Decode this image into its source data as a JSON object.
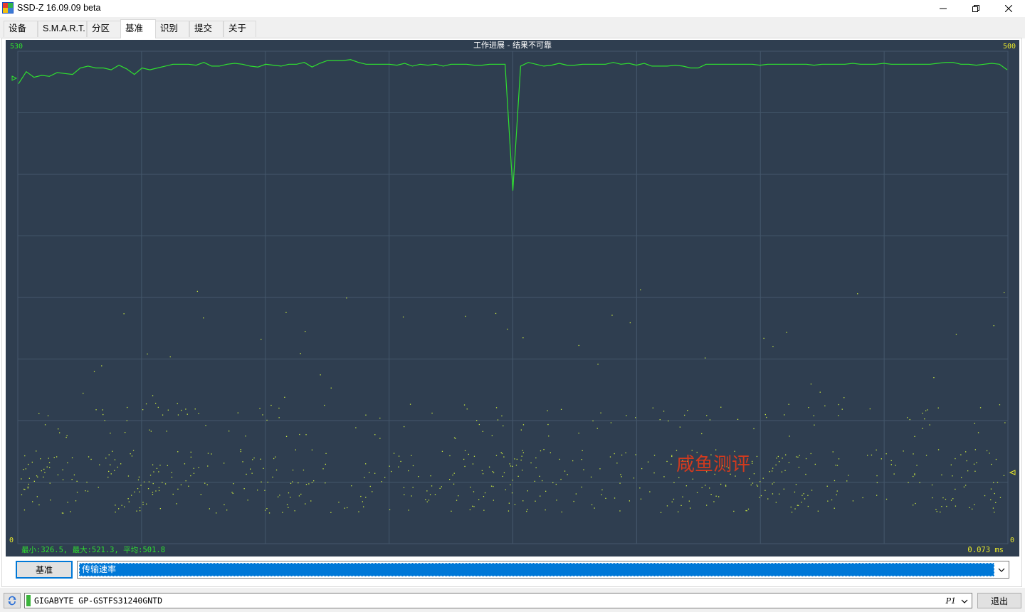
{
  "window": {
    "title": "SSD-Z 16.09.09 beta",
    "minimize_icon": "minimize-icon",
    "restore_icon": "restore-icon",
    "close_icon": "close-icon"
  },
  "tabs": [
    {
      "label": "设备"
    },
    {
      "label": "S.M.A.R.T."
    },
    {
      "label": "分区"
    },
    {
      "label": "基准",
      "active": true
    },
    {
      "label": "识别"
    },
    {
      "label": "提交"
    },
    {
      "label": "关于"
    }
  ],
  "chart_data": {
    "type": "line",
    "title": "工作进展 - 结果不可靠",
    "left_axis": {
      "max_label": "530",
      "min_label": "0",
      "range": [
        0,
        530
      ]
    },
    "right_axis": {
      "max_label": "500",
      "min_label": "0",
      "range": [
        0,
        500
      ]
    },
    "stats_text": "最小:326.5, 最大:521.3, 平均:501.8",
    "latency_text": "0.073 ms",
    "watermark": "咸鱼测评",
    "colors": {
      "background": "#2f3e50",
      "grid": "#44576b",
      "line": "#2fe02f",
      "dots": "#c8e640",
      "axis_label_left": "#2fe02f",
      "axis_label_right": "#e8e82a",
      "watermark": "#d23a1e"
    },
    "grid": true,
    "series": [
      {
        "values": [
          495,
          508,
          502,
          504,
          503,
          507,
          506,
          505,
          512,
          514,
          512,
          512,
          510,
          515,
          511,
          505,
          512,
          510,
          512,
          514,
          516,
          516,
          516,
          515,
          518,
          514,
          514,
          516,
          517,
          516,
          514,
          513,
          516,
          515,
          514,
          516,
          516,
          518,
          513,
          517,
          520,
          520,
          520,
          521,
          518,
          516,
          516,
          516,
          516,
          515,
          517,
          514,
          516,
          515,
          516,
          514,
          516,
          516,
          516,
          515,
          515,
          516,
          516,
          516,
          380,
          514,
          518,
          516,
          514,
          515,
          517,
          515,
          515,
          516,
          516,
          516,
          516,
          518,
          516,
          517,
          515,
          517,
          514,
          514,
          514,
          515,
          514,
          512,
          512,
          516,
          516,
          516,
          516,
          516,
          516,
          516,
          515,
          516,
          516,
          516,
          516,
          516,
          516,
          515,
          516,
          516,
          516,
          516,
          517,
          516,
          516,
          516,
          517,
          516,
          516,
          516,
          516,
          516,
          516,
          517,
          518,
          518,
          516,
          516,
          515,
          516,
          517,
          516,
          510
        ]
      }
    ],
    "dots_note_free": true
  },
  "controls": {
    "bench_button": "基准",
    "metric_select": "传输速率",
    "select_arrow_icon": "chevron-down-icon"
  },
  "statusbar": {
    "refresh_icon": "refresh-icon",
    "drive_name": "GIGABYTE GP-GSTFS31240GNTD",
    "drive_partition": "P1",
    "drive_arrow_icon": "chevron-down-icon",
    "exit_button": "退出"
  }
}
